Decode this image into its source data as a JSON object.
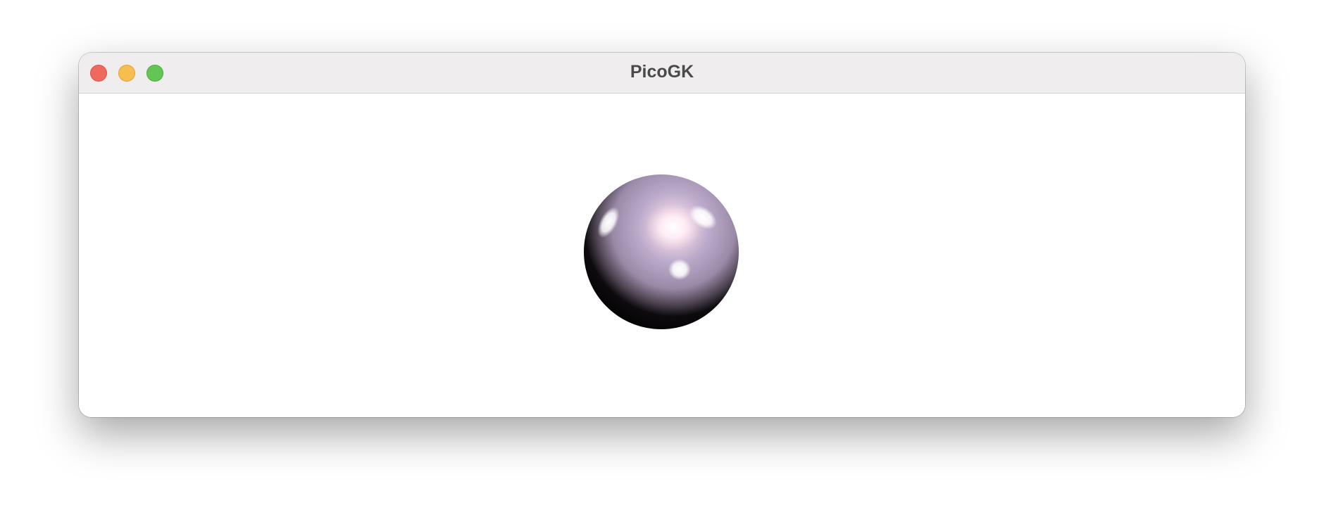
{
  "window": {
    "title": "PicoGK",
    "controls": {
      "close_color": "#ee6a5f",
      "minimize_color": "#f5be4f",
      "zoom_color": "#62c554"
    }
  },
  "viewport": {
    "background": "#ffffff",
    "object": "sphere",
    "sphere_tint": "#b7a7c8"
  }
}
